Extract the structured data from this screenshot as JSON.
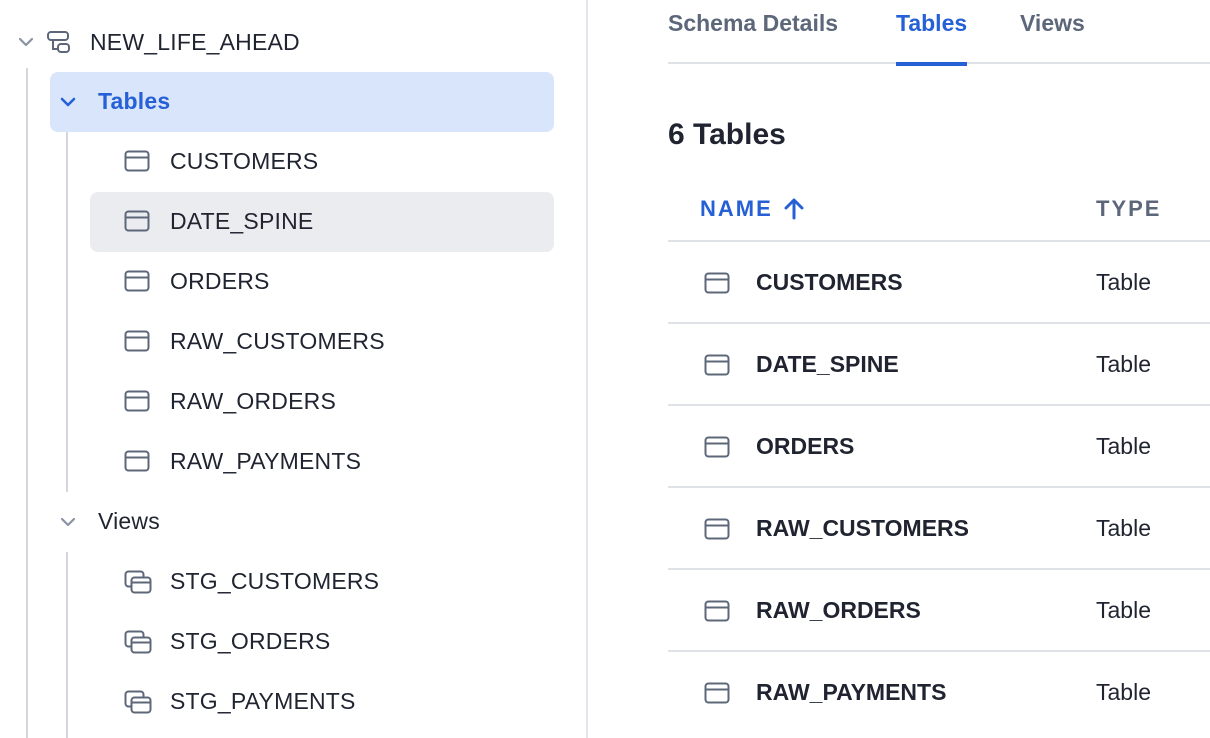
{
  "sidebar": {
    "schema": {
      "label": "NEW_LIFE_AHEAD",
      "icon": "schema-icon"
    },
    "tables_group": {
      "label": "Tables",
      "items": [
        {
          "label": "CUSTOMERS",
          "icon": "table-icon"
        },
        {
          "label": "DATE_SPINE",
          "icon": "table-icon",
          "selected": true
        },
        {
          "label": "ORDERS",
          "icon": "table-icon"
        },
        {
          "label": "RAW_CUSTOMERS",
          "icon": "table-icon"
        },
        {
          "label": "RAW_ORDERS",
          "icon": "table-icon"
        },
        {
          "label": "RAW_PAYMENTS",
          "icon": "table-icon"
        }
      ]
    },
    "views_group": {
      "label": "Views",
      "items": [
        {
          "label": "STG_CUSTOMERS",
          "icon": "view-icon"
        },
        {
          "label": "STG_ORDERS",
          "icon": "view-icon"
        },
        {
          "label": "STG_PAYMENTS",
          "icon": "view-icon"
        }
      ]
    }
  },
  "main": {
    "tabs": [
      {
        "label": "Schema Details"
      },
      {
        "label": "Tables",
        "active": true
      },
      {
        "label": "Views"
      }
    ],
    "count_title": "6 Tables",
    "table": {
      "headers": {
        "name": "NAME",
        "type": "TYPE",
        "sort": "ascending"
      },
      "rows": [
        {
          "name": "CUSTOMERS",
          "type": "Table"
        },
        {
          "name": "DATE_SPINE",
          "type": "Table"
        },
        {
          "name": "ORDERS",
          "type": "Table"
        },
        {
          "name": "RAW_CUSTOMERS",
          "type": "Table"
        },
        {
          "name": "RAW_ORDERS",
          "type": "Table"
        },
        {
          "name": "RAW_PAYMENTS",
          "type": "Table"
        }
      ]
    }
  },
  "colors": {
    "accent": "#2660d6",
    "selected_group_bg": "#d9e5fb",
    "selected_item_bg": "#ebecef",
    "text": "#1f2430",
    "muted": "#5d677a",
    "divider": "#dfe2e8"
  }
}
